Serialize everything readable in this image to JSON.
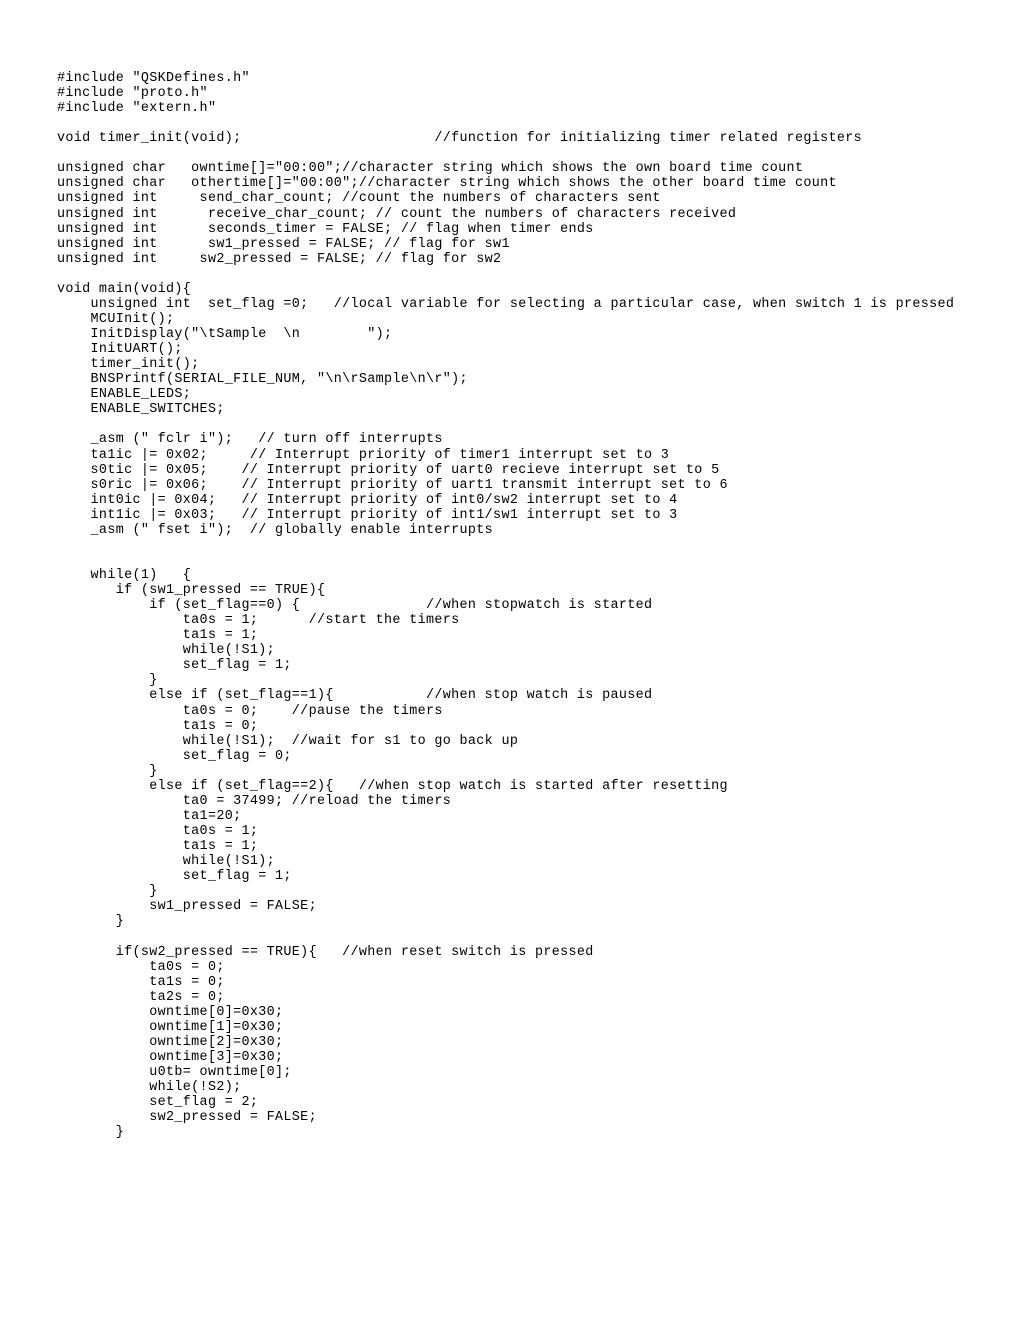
{
  "document": {
    "kind": "source-code-listing",
    "language": "C",
    "background_color": "#ffffff",
    "text_color": "#000000"
  },
  "code": {
    "lines": [
      "#include \"QSKDefines.h\"",
      "#include \"proto.h\"",
      "#include \"extern.h\"",
      "",
      "void timer_init(void);                       //function for initializing timer related registers",
      "",
      "unsigned char   owntime[]=\"00:00\";//character string which shows the own board time count",
      "unsigned char   othertime[]=\"00:00\";//character string which shows the other board time count",
      "unsigned int     send_char_count; //count the numbers of characters sent",
      "unsigned int      receive_char_count; // count the numbers of characters received",
      "unsigned int      seconds_timer = FALSE; // flag when timer ends",
      "unsigned int      sw1_pressed = FALSE; // flag for sw1",
      "unsigned int     sw2_pressed = FALSE; // flag for sw2",
      "",
      "void main(void){",
      "    unsigned int  set_flag =0;   //local variable for selecting a particular case, when switch 1 is pressed",
      "    MCUInit();",
      "    InitDisplay(\"\\tSample  \\n        \");",
      "    InitUART();",
      "    timer_init();",
      "    BNSPrintf(SERIAL_FILE_NUM, \"\\n\\rSample\\n\\r\");",
      "    ENABLE_LEDS;",
      "    ENABLE_SWITCHES;",
      "",
      "    _asm (\" fclr i\");   // turn off interrupts",
      "    ta1ic |= 0x02;     // Interrupt priority of timer1 interrupt set to 3",
      "    s0tic |= 0x05;    // Interrupt priority of uart0 recieve interrupt set to 5",
      "    s0ric |= 0x06;    // Interrupt priority of uart1 transmit interrupt set to 6",
      "    int0ic |= 0x04;   // Interrupt priority of int0/sw2 interrupt set to 4",
      "    int1ic |= 0x03;   // Interrupt priority of int1/sw1 interrupt set to 3",
      "    _asm (\" fset i\");  // globally enable interrupts",
      "",
      "",
      "    while(1)   {",
      "       if (sw1_pressed == TRUE){",
      "           if (set_flag==0) {               //when stopwatch is started",
      "               ta0s = 1;      //start the timers",
      "               ta1s = 1;",
      "               while(!S1);",
      "               set_flag = 1;",
      "           }",
      "           else if (set_flag==1){           //when stop watch is paused",
      "               ta0s = 0;    //pause the timers",
      "               ta1s = 0;",
      "               while(!S1);  //wait for s1 to go back up",
      "               set_flag = 0;",
      "           }",
      "           else if (set_flag==2){   //when stop watch is started after resetting",
      "               ta0 = 37499; //reload the timers",
      "               ta1=20;",
      "               ta0s = 1;",
      "               ta1s = 1;",
      "               while(!S1);",
      "               set_flag = 1;",
      "           }",
      "           sw1_pressed = FALSE;",
      "       }",
      "",
      "       if(sw2_pressed == TRUE){   //when reset switch is pressed",
      "           ta0s = 0;",
      "           ta1s = 0;",
      "           ta2s = 0;",
      "           owntime[0]=0x30;",
      "           owntime[1]=0x30;",
      "           owntime[2]=0x30;",
      "           owntime[3]=0x30;",
      "           u0tb= owntime[0];",
      "           while(!S2);",
      "           set_flag = 2;",
      "           sw2_pressed = FALSE;",
      "       }"
    ]
  }
}
